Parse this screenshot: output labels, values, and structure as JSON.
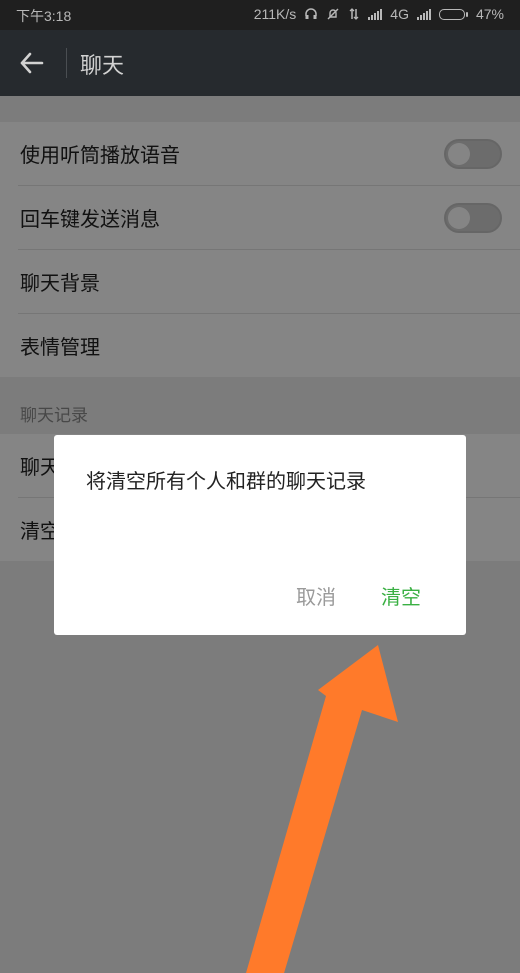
{
  "status_bar": {
    "time": "下午3:18",
    "net_speed": "211K/s",
    "network": "4G",
    "battery": "47%",
    "battery_level": 0.47
  },
  "app_bar": {
    "back_icon": "arrow-left-icon",
    "title": "聊天"
  },
  "settings": {
    "rows": [
      {
        "label": "使用听筒播放语音",
        "toggle": false
      },
      {
        "label": "回车键发送消息",
        "toggle": false
      },
      {
        "label": "聊天背景"
      },
      {
        "label": "表情管理"
      }
    ],
    "history_section": {
      "header": "聊天记录",
      "rows": [
        {
          "label": "聊天"
        },
        {
          "label": "清空"
        }
      ]
    }
  },
  "dialog": {
    "message": "将清空所有个人和群的聊天记录",
    "cancel_label": "取消",
    "confirm_label": "清空"
  },
  "colors": {
    "confirm": "#3ab043",
    "app_bar_bg": "#262a2e",
    "annotation_arrow": "#ff7a2a"
  }
}
